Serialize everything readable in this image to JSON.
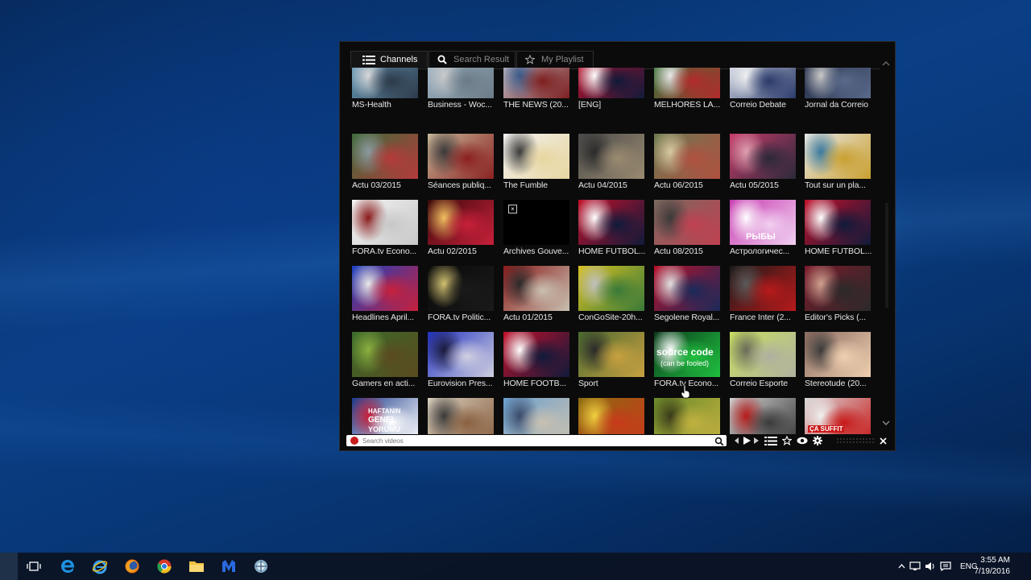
{
  "tabs": {
    "channels": "Channels",
    "search_result": "Search Result",
    "my_playlist": "My Playlist"
  },
  "channels": [
    {
      "title": "MS-Health",
      "palette": [
        "#6aa0c0",
        "#2d3a4a",
        "#d8d8d8"
      ]
    },
    {
      "title": "Business - Woc...",
      "palette": [
        "#9fb6c8",
        "#6b7b86",
        "#c9c9c9"
      ]
    },
    {
      "title": "THE NEWS (20...",
      "palette": [
        "#c0c6cf",
        "#7d1e1e",
        "#3a5a8a"
      ]
    },
    {
      "title": "[ENG]",
      "palette": [
        "#c3102a",
        "#101a3a",
        "#ffffff"
      ]
    },
    {
      "title": "MELHORES LA...",
      "palette": [
        "#2f7a3a",
        "#b32a2a",
        "#e9e9e9"
      ]
    },
    {
      "title": "Correio Debate",
      "palette": [
        "#d8dde8",
        "#2a3a6a",
        "#f0f0f0"
      ]
    },
    {
      "title": "Jornal da Correio",
      "palette": [
        "#1b2540",
        "#5a6a8a",
        "#c9c9c9"
      ]
    },
    {
      "title": "Actu 03/2015",
      "palette": [
        "#3c6b3a",
        "#b53a3a",
        "#8a9aa0"
      ]
    },
    {
      "title": "Séances publiq...",
      "palette": [
        "#c7b99a",
        "#8a2020",
        "#3a3a3a"
      ]
    },
    {
      "title": "The Fumble",
      "palette": [
        "#f1f1f1",
        "#e8d6a0",
        "#3a3a3a"
      ]
    },
    {
      "title": "Actu 04/2015",
      "palette": [
        "#4a4a4a",
        "#9a8a70",
        "#2a2a2a"
      ]
    },
    {
      "title": "Actu 06/2015",
      "palette": [
        "#6a7a50",
        "#b05040",
        "#d8c9a0"
      ]
    },
    {
      "title": "Actu 05/2015",
      "palette": [
        "#c83a6a",
        "#2a2a3a",
        "#e0a0b0"
      ]
    },
    {
      "title": "Tout sur un pla...",
      "palette": [
        "#e8e8e8",
        "#c9a030",
        "#3a7aa0"
      ]
    },
    {
      "title": "FORA.tv Econo...",
      "palette": [
        "#f4f4f4",
        "#c8c8c8",
        "#8a1a1a"
      ]
    },
    {
      "title": "Actu 02/2015",
      "palette": [
        "#3a0a0a",
        "#c8203a",
        "#f0c060"
      ]
    },
    {
      "title": "Archives Gouve...",
      "palette": [
        "#000000",
        "#000000",
        "#000000"
      ]
    },
    {
      "title": "HOME FUTBOL...",
      "palette": [
        "#c3102a",
        "#101a3a",
        "#ffffff"
      ]
    },
    {
      "title": "Actu 08/2015",
      "palette": [
        "#7a6a60",
        "#c04050",
        "#3a3a3a"
      ]
    },
    {
      "title": "Астрологичес...",
      "palette": [
        "#c83ab0",
        "#f0d0f0",
        "#ffffff"
      ]
    },
    {
      "title": "HOME FUTBOL...",
      "palette": [
        "#c3102a",
        "#101a3a",
        "#ffffff"
      ]
    },
    {
      "title": "Headlines April...",
      "palette": [
        "#1a40c0",
        "#c8203a",
        "#e8e8e8"
      ]
    },
    {
      "title": "FORA.tv Politic...",
      "palette": [
        "#0a0a0a",
        "#1a1a1a",
        "#d0c070"
      ]
    },
    {
      "title": "Actu 01/2015",
      "palette": [
        "#8a1a1a",
        "#c8c0b0",
        "#2a2a2a"
      ]
    },
    {
      "title": "ConGoSite-20h...",
      "palette": [
        "#d8c020",
        "#3a7a3a",
        "#c0c0c0"
      ]
    },
    {
      "title": "Segolene Royal...",
      "palette": [
        "#b8102a",
        "#1a2a5a",
        "#e0e0e0"
      ]
    },
    {
      "title": "France Inter (2...",
      "palette": [
        "#1a1a1a",
        "#b81a1a",
        "#5a5a5a"
      ]
    },
    {
      "title": "Editor's Picks (...",
      "palette": [
        "#7a1a2a",
        "#2a2a2a",
        "#d0a090"
      ]
    },
    {
      "title": "Gamers en acti...",
      "palette": [
        "#3a6a2a",
        "#5a4a20",
        "#8ab040"
      ]
    },
    {
      "title": "Eurovision Pres...",
      "palette": [
        "#2030c0",
        "#d0d0e0",
        "#1a1a3a"
      ]
    },
    {
      "title": "HOME FOOTB...",
      "palette": [
        "#c3102a",
        "#101a3a",
        "#ffffff"
      ]
    },
    {
      "title": "Sport",
      "palette": [
        "#4a6a30",
        "#c8a040",
        "#2a2a2a"
      ]
    },
    {
      "title": "FORA.tv Econo...",
      "palette": [
        "#0a3a1a",
        "#20c040",
        "#ffffff"
      ]
    },
    {
      "title": "Correio Esporte",
      "palette": [
        "#c8e060",
        "#b0b0a0",
        "#6a6a5a"
      ]
    },
    {
      "title": "Stereotude (20...",
      "palette": [
        "#8a6a60",
        "#f0d0b0",
        "#3a3a3a"
      ]
    },
    {
      "title": "",
      "palette": [
        "#1a3a8a",
        "#ffffff",
        "#c8203a"
      ]
    },
    {
      "title": "",
      "palette": [
        "#d8d0c0",
        "#8a6040",
        "#3a3a3a"
      ]
    },
    {
      "title": "",
      "palette": [
        "#6aa0d0",
        "#c8c0b0",
        "#3a4a6a"
      ]
    },
    {
      "title": "",
      "palette": [
        "#8a6a10",
        "#c83a1a",
        "#f0d040"
      ]
    },
    {
      "title": "",
      "palette": [
        "#6a8a2a",
        "#c0b040",
        "#3a3a1a"
      ]
    },
    {
      "title": "",
      "palette": [
        "#d0d0d0",
        "#3a3a3a",
        "#b81a1a"
      ]
    },
    {
      "title": "",
      "palette": [
        "#d8d8d8",
        "#c81a1a",
        "#f0f0f0"
      ]
    }
  ],
  "thumb_text": {
    "source_code": "source code",
    "can_be_fooled": "(can be fooled)",
    "ryby": "РЫБЫ",
    "haftanin": "HAFTANIN",
    "genel": "GENEL",
    "yorumu": "YORUMU",
    "ca_suffit": "ÇA SUFFIT"
  },
  "search": {
    "placeholder": "Search videos"
  },
  "taskbar": {
    "language": "ENG",
    "time": "3:55 AM",
    "date": "7/19/2016"
  }
}
